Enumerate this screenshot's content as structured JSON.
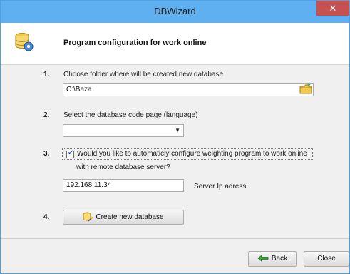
{
  "window": {
    "title": "DBWizard",
    "close_glyph": "✕"
  },
  "header": {
    "title": "Program configuration for work online",
    "icon": "database-gear-icon"
  },
  "steps": {
    "step1": {
      "number": "1.",
      "label": "Choose folder where will be created new database",
      "folder_value": "C:\\Baza"
    },
    "step2": {
      "number": "2.",
      "label": "Select the database code page (language)",
      "selected": ""
    },
    "step3": {
      "number": "3.",
      "checked": true,
      "label_line1": "Would you like to automaticly configure weighting program to work online",
      "label_line2": "with remote database server?",
      "ip_value": "192.168.11.34",
      "ip_label": "Server Ip adress"
    },
    "step4": {
      "number": "4.",
      "button_label": "Create new database"
    }
  },
  "footer": {
    "back_label": "Back",
    "close_label": "Close"
  },
  "colors": {
    "titlebar": "#5fb0f0",
    "close": "#c75050",
    "accent_green": "#3aa33a"
  }
}
